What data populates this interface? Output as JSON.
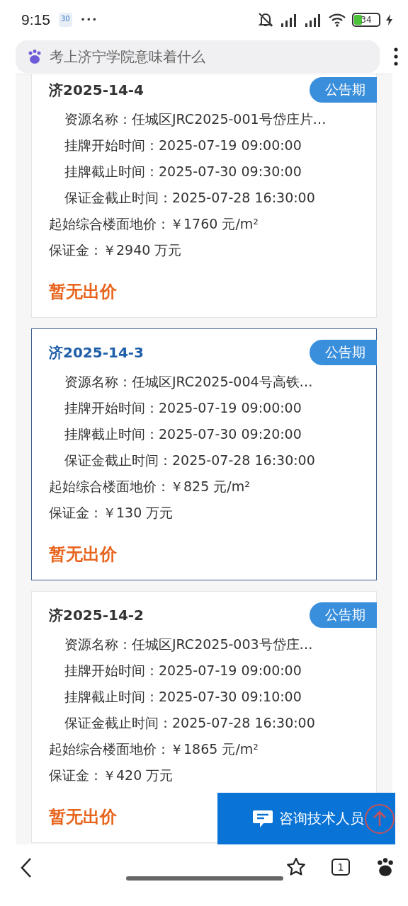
{
  "status_bar": {
    "time": "9:15",
    "calendar_badge": "30",
    "more": "•••",
    "battery": "34"
  },
  "search": {
    "placeholder": "考上济宁学院意味着什么"
  },
  "cards": [
    {
      "code": "济2025-14-4",
      "selected": false,
      "status": "公告期",
      "details": [
        "资源名称：任城区JRC2025-001号岱庄片…",
        "挂牌开始时间：2025-07-19 09:00:00",
        "挂牌截止时间：2025-07-30 09:30:00",
        "保证金截止时间：2025-07-28 16:30:00"
      ],
      "summary": [
        "起始综合楼面地价：￥1760 元/m²",
        "保证金：￥2940 万元"
      ],
      "bid": "暂无出价"
    },
    {
      "code": "济2025-14-3",
      "selected": true,
      "status": "公告期",
      "details": [
        "资源名称：任城区JRC2025-004号高铁…",
        "挂牌开始时间：2025-07-19 09:00:00",
        "挂牌截止时间：2025-07-30 09:20:00",
        "保证金截止时间：2025-07-28 16:30:00"
      ],
      "summary": [
        "起始综合楼面地价：￥825 元/m²",
        "保证金：￥130 万元"
      ],
      "bid": "暂无出价"
    },
    {
      "code": "济2025-14-2",
      "selected": false,
      "status": "公告期",
      "details": [
        "资源名称：任城区JRC2025-003号岱庄…",
        "挂牌开始时间：2025-07-19 09:00:00",
        "挂牌截止时间：2025-07-30 09:10:00",
        "保证金截止时间：2025-07-28 16:30:00"
      ],
      "summary": [
        "起始综合楼面地价：￥1865 元/m²",
        "保证金：￥420 万元"
      ],
      "bid": "暂无出价"
    }
  ],
  "consult_button": {
    "label": "咨询技术人员"
  },
  "bottom_nav": {
    "tab_count": "1"
  }
}
